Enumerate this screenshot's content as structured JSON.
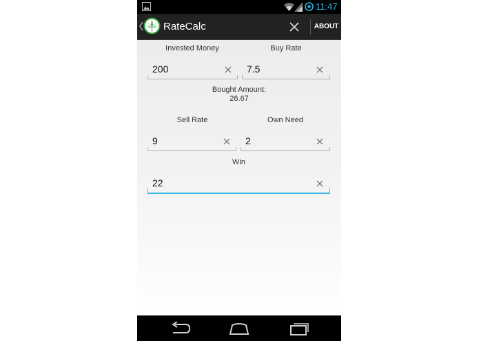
{
  "status_bar": {
    "time": "11:47",
    "icons": [
      "gallery-icon",
      "wifi-icon",
      "signal-icon",
      "sync-icon"
    ],
    "clock_color": "#33b5e5"
  },
  "action_bar": {
    "title": "RateCalc",
    "about_label": "ABOUT",
    "icons": [
      "up-caret-icon",
      "cannabis-leaf-logo",
      "close-icon"
    ]
  },
  "form": {
    "invested_money": {
      "label": "Invested Money",
      "value": "200"
    },
    "buy_rate": {
      "label": "Buy Rate",
      "value": "7.5"
    },
    "bought_amount": {
      "label": "Bought Amount:",
      "value": "26.67"
    },
    "sell_rate": {
      "label": "Sell Rate",
      "value": "9"
    },
    "own_need": {
      "label": "Own Need",
      "value": "2"
    },
    "win": {
      "label": "Win",
      "value": "22"
    }
  },
  "nav_bar": {
    "icons": [
      "back-icon",
      "home-icon",
      "recent-apps-icon"
    ]
  },
  "colors": {
    "accent": "#33b5e5",
    "action_bar": "#222222",
    "logo_green": "#2e9e3a"
  }
}
